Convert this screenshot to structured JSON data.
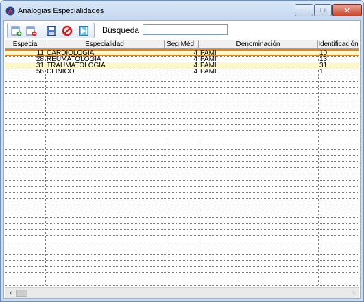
{
  "window": {
    "title": "Analogias Especialidades",
    "min_glyph": "─",
    "max_glyph": "□",
    "close_glyph": "✕"
  },
  "toolbar": {
    "buttons": [
      {
        "icon": "add-record-icon"
      },
      {
        "icon": "delete-record-icon"
      },
      {
        "icon": "save-icon"
      },
      {
        "icon": "cancel-icon"
      },
      {
        "icon": "exit-icon"
      }
    ]
  },
  "search": {
    "label": "Búsqueda",
    "value": ""
  },
  "grid": {
    "columns": [
      "Especia",
      "Especialidad",
      "Seg Méd.",
      "Denominación",
      "Identificación"
    ],
    "rows": [
      {
        "especia": "11",
        "especialidad": "CARDIOLOGÍA",
        "seg_med": "4",
        "denominacion": "PAMI",
        "identificacion": "10"
      },
      {
        "especia": "28",
        "especialidad": "REUMATOLOGÍA",
        "seg_med": "4",
        "denominacion": "PAMI",
        "identificacion": "13"
      },
      {
        "especia": "31",
        "especialidad": "TRAUMATOLOGÍA",
        "seg_med": "4",
        "denominacion": "PAMI",
        "identificacion": "31"
      },
      {
        "especia": "56",
        "especialidad": "CLÍNICO",
        "seg_med": "4",
        "denominacion": "PAMI",
        "identificacion": "1"
      }
    ],
    "selected_row": 0,
    "highlighted_rows": [
      0,
      2
    ]
  },
  "scrollbar": {
    "left_glyph": "‹",
    "right_glyph": "›"
  },
  "colors": {
    "row_highlight": "#fdf8c8",
    "selection_border": "#e8821e"
  }
}
